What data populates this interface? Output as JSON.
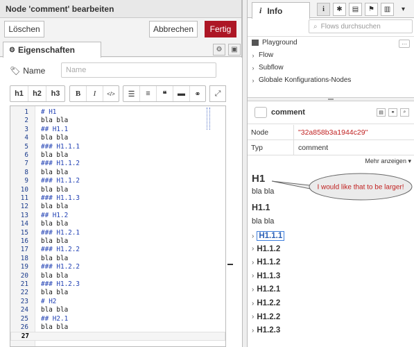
{
  "editor_panel": {
    "title": "Node 'comment' bearbeiten",
    "delete_label": "Löschen",
    "cancel_label": "Abbrechen",
    "done_label": "Fertig",
    "tab_label": "Eigenschaften",
    "name_label": "Name",
    "name_placeholder": "Name",
    "toolbar": {
      "h1": "h1",
      "h2": "h2",
      "h3": "h3",
      "bold": "B",
      "italic": "I",
      "code": "</>"
    },
    "code_lines": [
      "# H1",
      "bla bla",
      "## H1.1",
      "bla bla",
      "### H1.1.1",
      "bla bla",
      "### H1.1.2",
      "bla bla",
      "### H1.1.2",
      "bla bla",
      "### H1.1.3",
      "bla bla",
      "## H1.2",
      "bla bla",
      "### H1.2.1",
      "bla bla",
      "### H1.2.2",
      "bla bla",
      "### H1.2.2",
      "bla bla",
      "### H1.2.3",
      "bla bla",
      "# H2",
      "bla bla",
      "## H2.1",
      "bla bla",
      ""
    ],
    "line_numbers": [
      "1",
      "2",
      "3",
      "4",
      "5",
      "6",
      "7",
      "8",
      "9",
      "10",
      "11",
      "12",
      "13",
      "14",
      "15",
      "16",
      "17",
      "18",
      "19",
      "20",
      "21",
      "22",
      "23",
      "24",
      "25",
      "26",
      "27"
    ],
    "active_line": 27
  },
  "sidebar": {
    "tab_label": "Info",
    "search_placeholder": "Flows durchsuchen",
    "tree": {
      "playground": "Playground",
      "flow": "Flow",
      "subflow": "Subflow",
      "global": "Globale Konfigurations-Nodes"
    },
    "node": {
      "name": "comment",
      "key_node": "Node",
      "value_node": "\"32a858b3a1944c29\"",
      "key_type": "Typ",
      "value_type": "comment",
      "show_more": "Mehr anzeigen"
    },
    "doc": {
      "h1": "H1",
      "p1": "bla bla",
      "h2": "H1.1",
      "p2": "bla bla",
      "sections": [
        "H1.1.1",
        "H1.1.2",
        "H1.1.2",
        "H1.1.3",
        "H1.2.1",
        "H1.2.2",
        "H1.2.2",
        "H1.2.3"
      ]
    }
  },
  "annotation": {
    "text": "I would like that to be larger!",
    "text_color": "#c0201f"
  },
  "colors": {
    "done_button": "#ad1625",
    "heading_code": "#1f3fb3"
  }
}
